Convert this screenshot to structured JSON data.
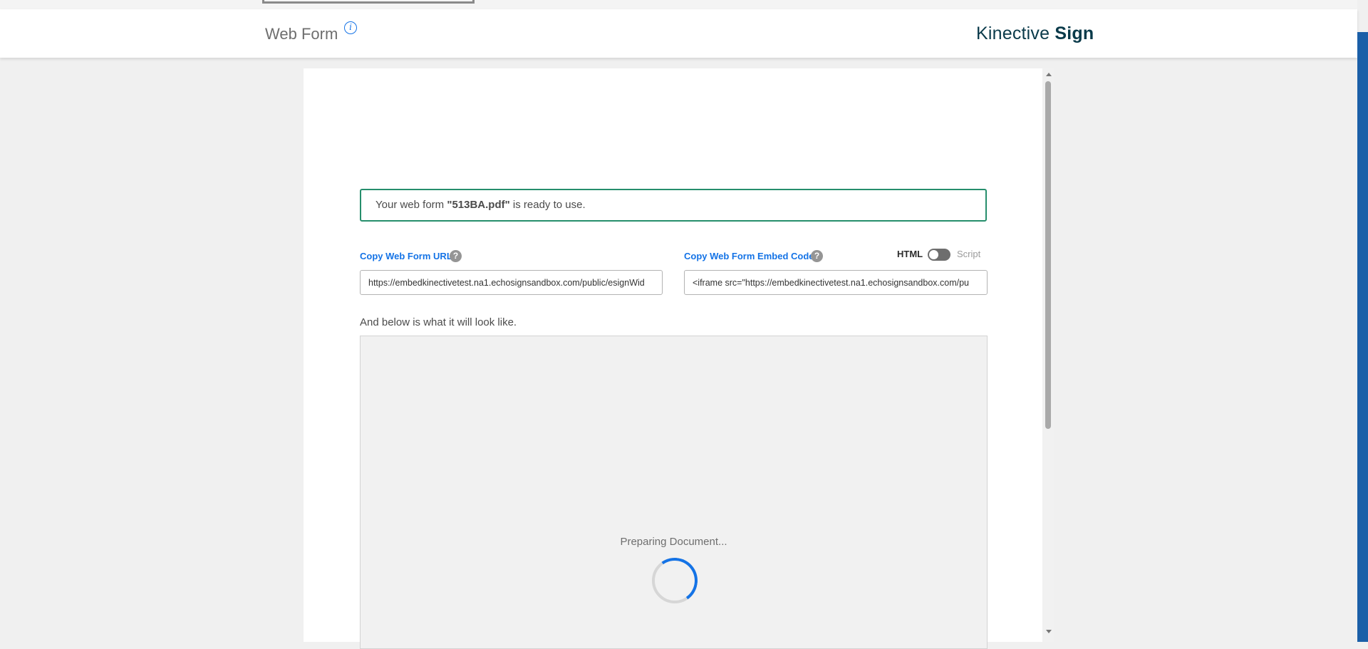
{
  "header": {
    "title": "Web Form",
    "info_icon": "i",
    "brand_regular": "Kinective",
    "brand_bold": "Sign"
  },
  "banner": {
    "prefix": "Your web form ",
    "filename": "\"513BA.pdf\"",
    "suffix": " is ready to use."
  },
  "url_field": {
    "label": "Copy Web Form URL",
    "help": "?",
    "value": "https://embedkinectivetest.na1.echosignsandbox.com/public/esignWid"
  },
  "embed_field": {
    "label": "Copy Web Form Embed Code",
    "help": "?",
    "value": "<iframe src=\"https://embedkinectivetest.na1.echosignsandbox.com/pu"
  },
  "format_toggle": {
    "selected_label": "HTML",
    "other_label": "Script"
  },
  "preview": {
    "caption": "And below is what it will look like.",
    "status": "Preparing Document..."
  },
  "colors": {
    "accent": "#1473e6",
    "success_border": "#268e6c",
    "brand": "#0a3a4a"
  }
}
